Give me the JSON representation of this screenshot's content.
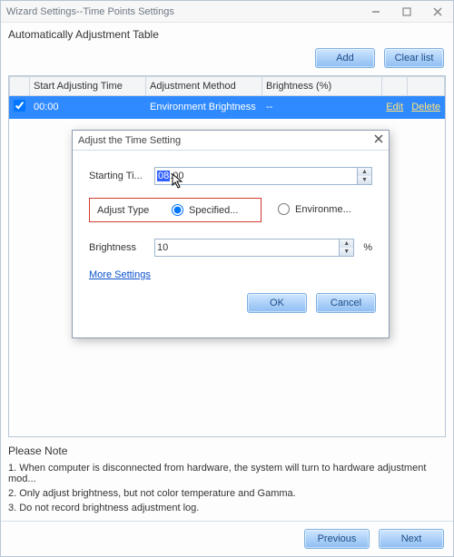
{
  "window": {
    "title": "Wizard Settings--Time Points Settings"
  },
  "section": {
    "table_label": "Automatically Adjustment Table"
  },
  "buttons": {
    "add": "Add",
    "clear_list": "Clear list",
    "previous": "Previous",
    "next": "Next",
    "ok": "OK",
    "cancel": "Cancel"
  },
  "table": {
    "headers": {
      "start": "Start Adjusting Time",
      "method": "Adjustment Method",
      "brightness": "Brightness (%)"
    },
    "row": {
      "checked": true,
      "start": "00:00",
      "method": "Environment Brightness",
      "brightness": "--",
      "edit": "Edit",
      "delete": "Delete"
    }
  },
  "dialog": {
    "title": "Adjust the Time Setting",
    "starting_label": "Starting Ti...",
    "starting_value_hl": "08",
    "starting_value_rest": ":00",
    "adjust_type_label": "Adjust Type",
    "opt_specified": "Specified...",
    "opt_environment": "Environme...",
    "brightness_label": "Brightness",
    "brightness_value": "10",
    "pct": "%",
    "more_settings": "More Settings"
  },
  "notes": {
    "header": "Please Note",
    "n1": "1. When computer is disconnected from hardware, the system will turn to hardware adjustment mod...",
    "n2": "2. Only adjust brightness, but not color temperature and Gamma.",
    "n3": "3. Do not record brightness adjustment log."
  }
}
